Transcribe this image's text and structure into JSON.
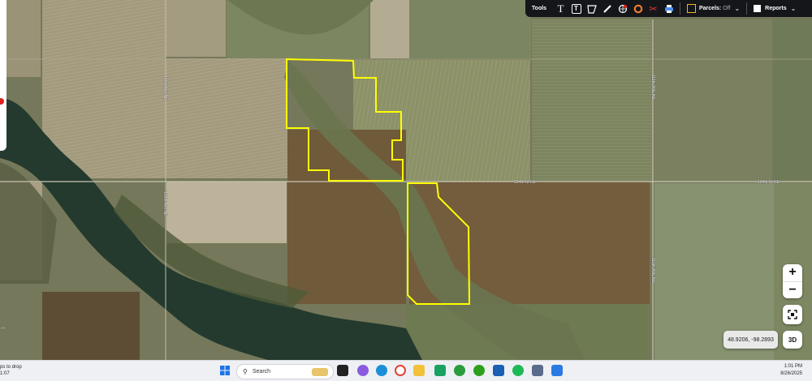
{
  "toolbar": {
    "tools_label": "Tools",
    "parcels_label": "Parcels:",
    "parcels_state": "Off",
    "reports_label": "Reports",
    "tool_icons": [
      "text-icon",
      "text-box-icon",
      "polygon-icon",
      "ruler-icon",
      "globe-pin-icon",
      "circle-icon",
      "scissors-icon",
      "print-icon"
    ]
  },
  "map": {
    "roads": {
      "h_road_label": "104th St NE",
      "h_road_label_right": "104th St NE",
      "v_road_label": "111th AVE NE",
      "v_road_label_lower": "111th AVE NE",
      "v_road_left": "100th Ave NE",
      "v_road_left_2": "100th Ave NE"
    },
    "left_edge_text": "ox",
    "coords": "48.9206, -98.2893",
    "view_3d": "3D"
  },
  "taskbar": {
    "left_text_1": "ps to drop",
    "left_text_2": "1:07",
    "search_placeholder": "Search",
    "time": "1:01 PM",
    "date": "8/26/2025"
  },
  "colors": {
    "parcel_outline": "#ffff00",
    "toolbar_bg": "#15161a"
  }
}
